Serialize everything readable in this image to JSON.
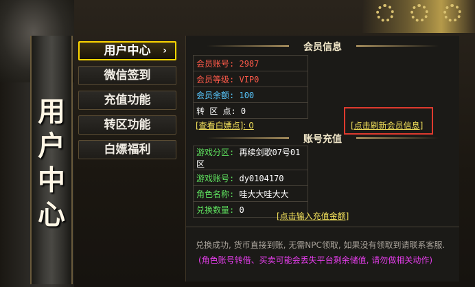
{
  "sidebar": {
    "title_chars": [
      "用",
      "户",
      "中",
      "心"
    ]
  },
  "menu": {
    "items": [
      {
        "label": "用户中心",
        "active": true
      },
      {
        "label": "微信签到",
        "active": false
      },
      {
        "label": "充值功能",
        "active": false
      },
      {
        "label": "转区功能",
        "active": false
      },
      {
        "label": "白嫖福利",
        "active": false
      }
    ],
    "active_arrow": "›"
  },
  "member_info": {
    "section_title": "会员信息",
    "rows": [
      {
        "label": "会员账号:",
        "value": "2987",
        "color": "#ff5a4a"
      },
      {
        "label": "会员等级:",
        "value": "VIP0",
        "color": "#ff5a4a"
      },
      {
        "label": "会员余额:",
        "value": "100",
        "color": "#58c8ff"
      },
      {
        "label": "转 区 点:",
        "value": "0",
        "color": "#ffffff"
      }
    ],
    "view_points_link": "[查看白嫖点]: 0",
    "refresh_link": "[点击刷新会员信息]"
  },
  "recharge": {
    "section_title": "账号充值",
    "rows": [
      {
        "label": "游戏分区:",
        "value": "再续剑歌07号01区"
      },
      {
        "label": "游戏账号:",
        "value": "dy0104170"
      },
      {
        "label": "角色名称:",
        "value": "哇大大哇大大"
      },
      {
        "label": "兑换数量:",
        "value": "0"
      }
    ],
    "label_color": "#5ee05e",
    "input_amount_link": "[点击输入充值金额]"
  },
  "notices": {
    "line1": "兑换成功, 货币直接到账, 无需NPC领取, 如果没有领取到请联系客服.",
    "line2": "(角色账号转借、买卖可能会丢失平台剩余储值, 请勿做相关动作)"
  }
}
